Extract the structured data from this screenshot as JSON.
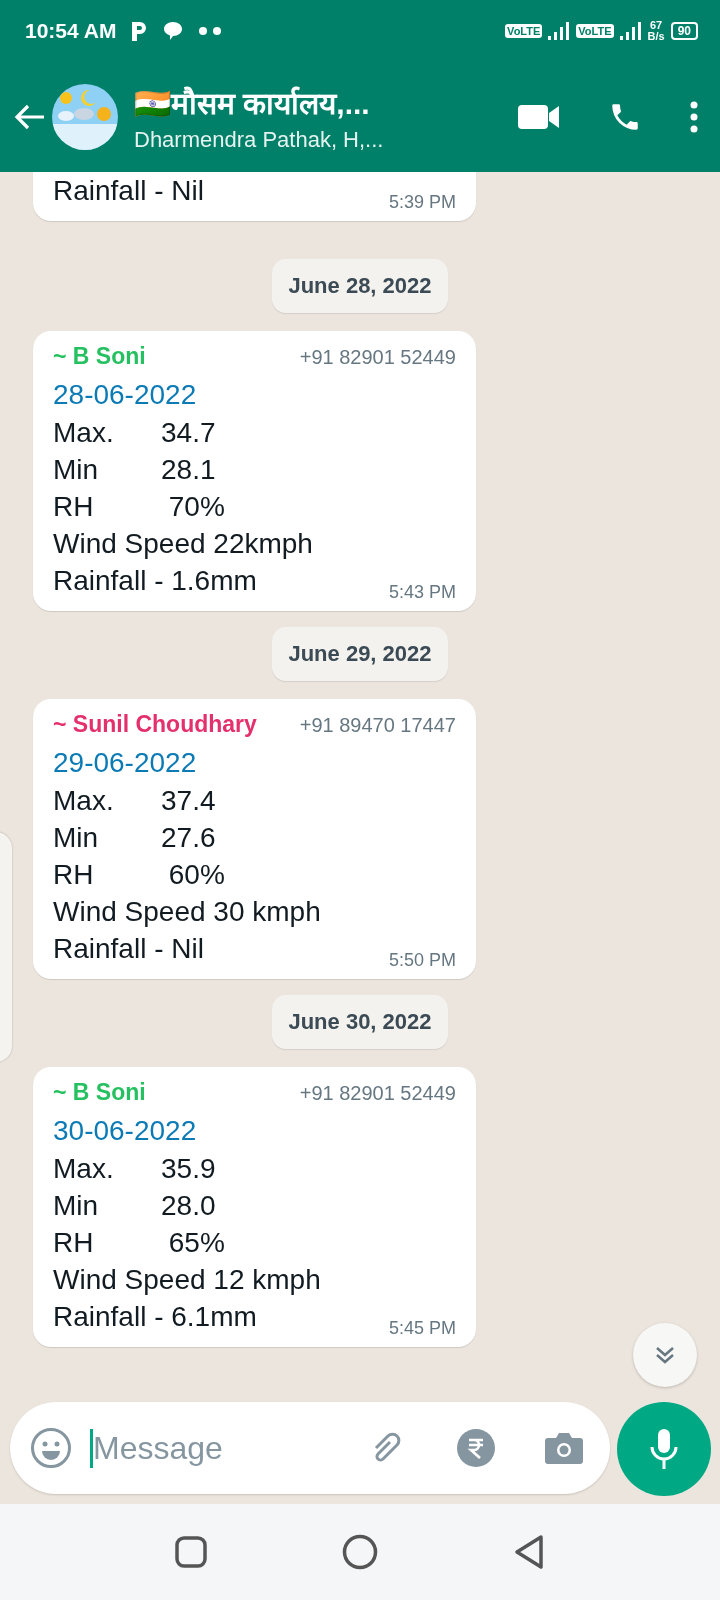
{
  "status_bar": {
    "time": "10:54 AM",
    "network_1": "VoLTE",
    "network_2": "VoLTE",
    "speed_value": "67",
    "speed_unit": "B/s",
    "battery": "90"
  },
  "header": {
    "title": "🇮🇳मौसम कार्यालय,...",
    "subtitle": "Dharmendra Pathak, H,..."
  },
  "messages": [
    {
      "kind": "partial",
      "lines": [
        {
          "label": "Rainfall - Nil"
        }
      ],
      "time": "5:39 PM"
    },
    {
      "kind": "date",
      "text": "June 28, 2022"
    },
    {
      "kind": "message",
      "sender": "~ B Soni",
      "color": "#25c05f",
      "phone": "+91 82901 52449",
      "date": "28-06-2022",
      "lines": [
        {
          "label": "Max.",
          "value": "34.7"
        },
        {
          "label": "Min",
          "value": "28.1"
        },
        {
          "label": "RH",
          "value": " 70%"
        },
        {
          "label": "Wind Speed 22kmph"
        },
        {
          "label": "Rainfall - 1.6mm"
        }
      ],
      "time": "5:43 PM"
    },
    {
      "kind": "date",
      "text": "June 29, 2022"
    },
    {
      "kind": "message",
      "sender": "~ Sunil Choudhary",
      "color": "#e4306c",
      "phone": "+91 89470 17447",
      "date": "29-06-2022",
      "lines": [
        {
          "label": "Max.",
          "value": "37.4"
        },
        {
          "label": "Min",
          "value": "27.6"
        },
        {
          "label": "RH",
          "value": " 60%"
        },
        {
          "label": "Wind Speed 30 kmph"
        },
        {
          "label": "Rainfall - Nil"
        }
      ],
      "time": "5:50 PM"
    },
    {
      "kind": "date",
      "text": "June 30, 2022"
    },
    {
      "kind": "message",
      "sender": "~ B Soni",
      "color": "#25c05f",
      "phone": "+91 82901 52449",
      "date": "30-06-2022",
      "lines": [
        {
          "label": "Max.",
          "value": "35.9"
        },
        {
          "label": "Min",
          "value": "28.0"
        },
        {
          "label": "RH",
          "value": " 65%"
        },
        {
          "label": "Wind Speed 12 kmph"
        },
        {
          "label": "Rainfall - 6.1mm"
        }
      ],
      "time": "5:45 PM"
    }
  ],
  "composer": {
    "placeholder": "Message"
  }
}
